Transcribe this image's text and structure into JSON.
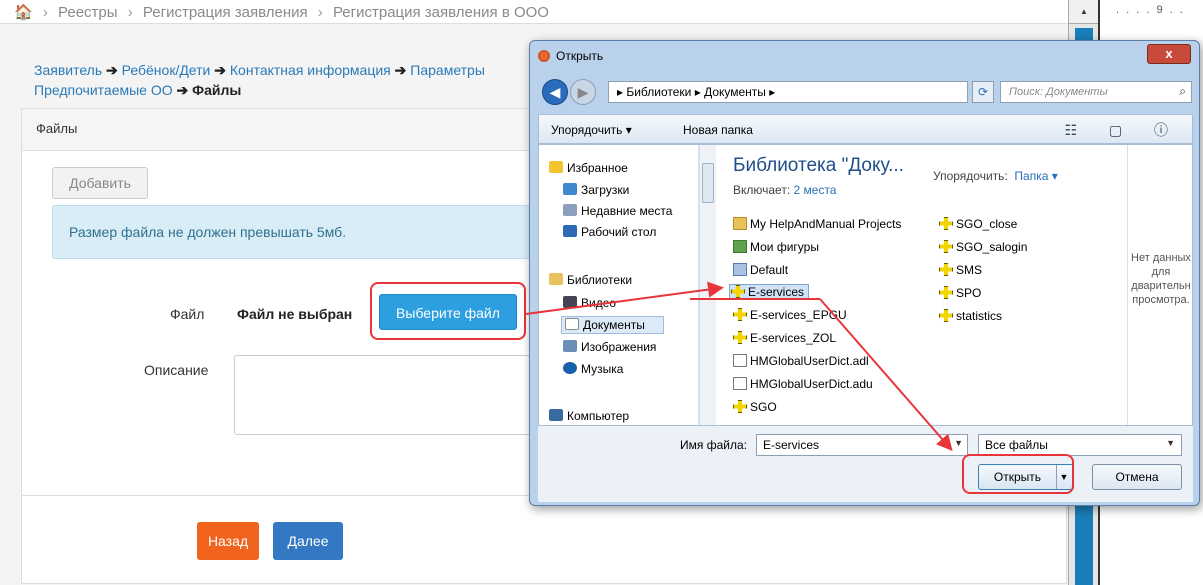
{
  "topbar": {
    "home_icon": "home-icon",
    "items": [
      "Реестры",
      "Регистрация заявления",
      "Регистрация заявления в ООО"
    ]
  },
  "steps": {
    "items": [
      "Заявитель",
      "Ребёнок/Дети",
      "Контактная информация",
      "Параметры",
      "Предпочитаемые ОО"
    ],
    "current": "Файлы"
  },
  "panel": {
    "title": "Файлы",
    "add_button": "Добавить",
    "alert": "Размер файла не должен превышать 5мб.",
    "file_label": "Файл",
    "no_file": "Файл не выбран",
    "choose_button": "Выберите файл",
    "description_label": "Описание",
    "back_button": "Назад",
    "next_button": "Далее"
  },
  "far_right": {
    "dots": ". . . . 9 . ."
  },
  "dialog": {
    "title": "Открыть",
    "close": "x",
    "address": "▸ Библиотеки ▸ Документы ▸",
    "search_placeholder": "Поиск: Документы",
    "toolbar": {
      "organize": "Упорядочить ▾",
      "new_folder": "Новая папка"
    },
    "nav": {
      "favorites": "Избранное",
      "downloads": "Загрузки",
      "recent": "Недавние места",
      "desktop": "Рабочий стол",
      "libraries": "Библиотеки",
      "video": "Видео",
      "documents": "Документы",
      "images": "Изображения",
      "music": "Музыка",
      "computer": "Компьютер"
    },
    "library_heading": "Библиотека \"Доку...",
    "includes_label": "Включает:",
    "includes_value": "2 места",
    "sort_label": "Упорядочить:",
    "sort_value": "Папка ▾",
    "preview_text": "Нет данных для дварительн просмотра.",
    "files_col1": [
      "My HelpAndManual Projects",
      "Мои фигуры",
      "Default",
      "E-services",
      "E-services_EPGU",
      "E-services_ZOL",
      "HMGlobalUserDict.adl",
      "HMGlobalUserDict.adu",
      "SGO"
    ],
    "files_col2": [
      "SGO_close",
      "SGO_salogin",
      "SMS",
      "SPO",
      "statistics"
    ],
    "file_name_label": "Имя файла:",
    "file_name_value": "E-services",
    "file_type": "Все файлы",
    "open_button": "Открыть",
    "cancel_button": "Отмена"
  },
  "colors": {
    "link": "#2a7ab8",
    "primary": "#2d9fe0",
    "back": "#f0631c",
    "next": "#3378c2",
    "highlight": "#e8353a"
  }
}
